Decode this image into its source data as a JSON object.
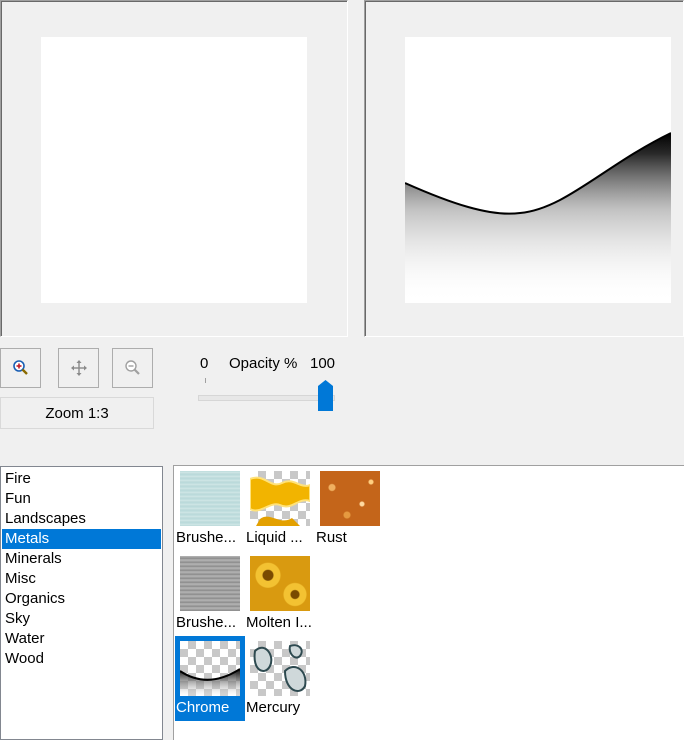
{
  "preview": {
    "before_label": "",
    "after_label": ""
  },
  "toolbar": {
    "zoom_in_icon": "zoom-in-icon",
    "pan_icon": "move-icon",
    "zoom_out_icon": "zoom-out-icon",
    "zoom_label": "Zoom 1:3"
  },
  "opacity": {
    "min_label": "0",
    "title": "Opacity %",
    "max_label": "100",
    "value": 100
  },
  "categories": [
    {
      "label": "Fire"
    },
    {
      "label": "Fun"
    },
    {
      "label": "Landscapes"
    },
    {
      "label": "Metals",
      "selected": true
    },
    {
      "label": "Minerals"
    },
    {
      "label": "Misc"
    },
    {
      "label": "Organics"
    },
    {
      "label": "Sky"
    },
    {
      "label": "Water"
    },
    {
      "label": "Wood"
    }
  ],
  "textures": [
    {
      "label": "Brushe...",
      "style": "brushed-cyan"
    },
    {
      "label": "Liquid ...",
      "style": "liquid-gold"
    },
    {
      "label": "Rust",
      "style": "rust"
    },
    {
      "label": "Brushe...",
      "style": "brushed-gray"
    },
    {
      "label": "Molten I...",
      "style": "molten-iron"
    },
    {
      "label": "Chrome",
      "style": "chrome",
      "selected": true
    },
    {
      "label": "Mercury",
      "style": "mercury"
    }
  ],
  "colors": {
    "selection": "#0078d7",
    "slider_thumb": "#0078d7"
  }
}
